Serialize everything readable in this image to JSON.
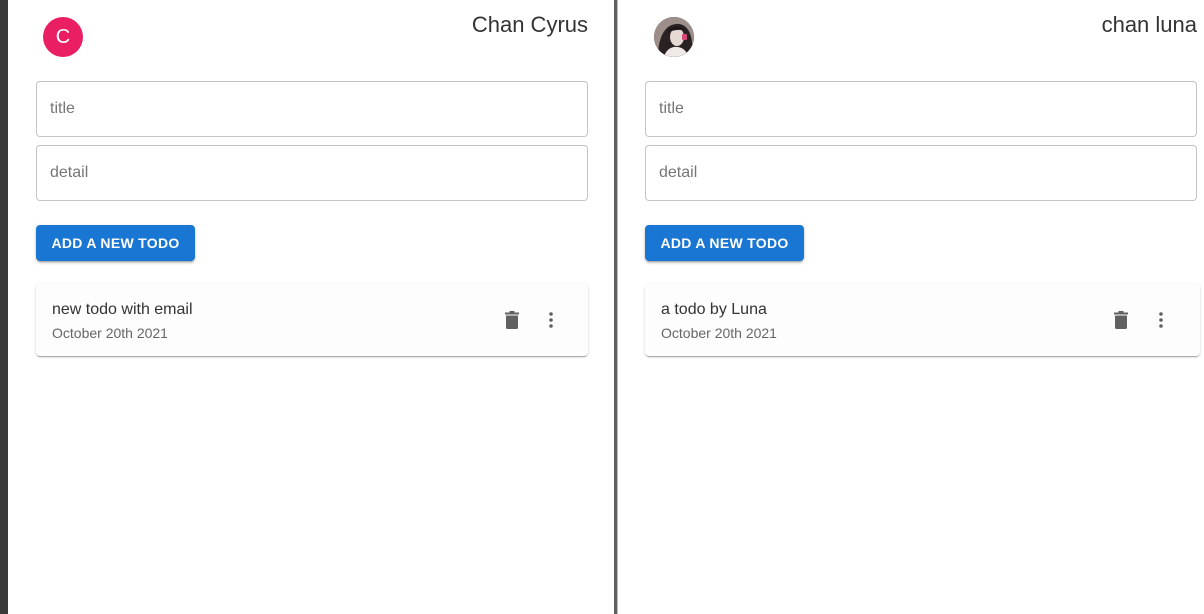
{
  "panes": [
    {
      "user_name": "Chan Cyrus",
      "avatar": {
        "type": "letter",
        "letter": "C",
        "color": "#e91e63"
      },
      "title_placeholder": "title",
      "detail_placeholder": "detail",
      "add_button_label": "ADD A NEW TODO",
      "todos": [
        {
          "title": "new todo with email",
          "date": "October 20th 2021"
        }
      ]
    },
    {
      "user_name": "chan luna",
      "avatar": {
        "type": "photo"
      },
      "title_placeholder": "title",
      "detail_placeholder": "detail",
      "add_button_label": "ADD A NEW TODO",
      "todos": [
        {
          "title": "a todo by Luna",
          "date": "October 20th 2021"
        }
      ]
    }
  ],
  "icons": {
    "delete": "trash-icon",
    "more": "more-vert-icon"
  },
  "colors": {
    "primary": "#1976d2",
    "avatar_letter_bg": "#e91e63"
  }
}
